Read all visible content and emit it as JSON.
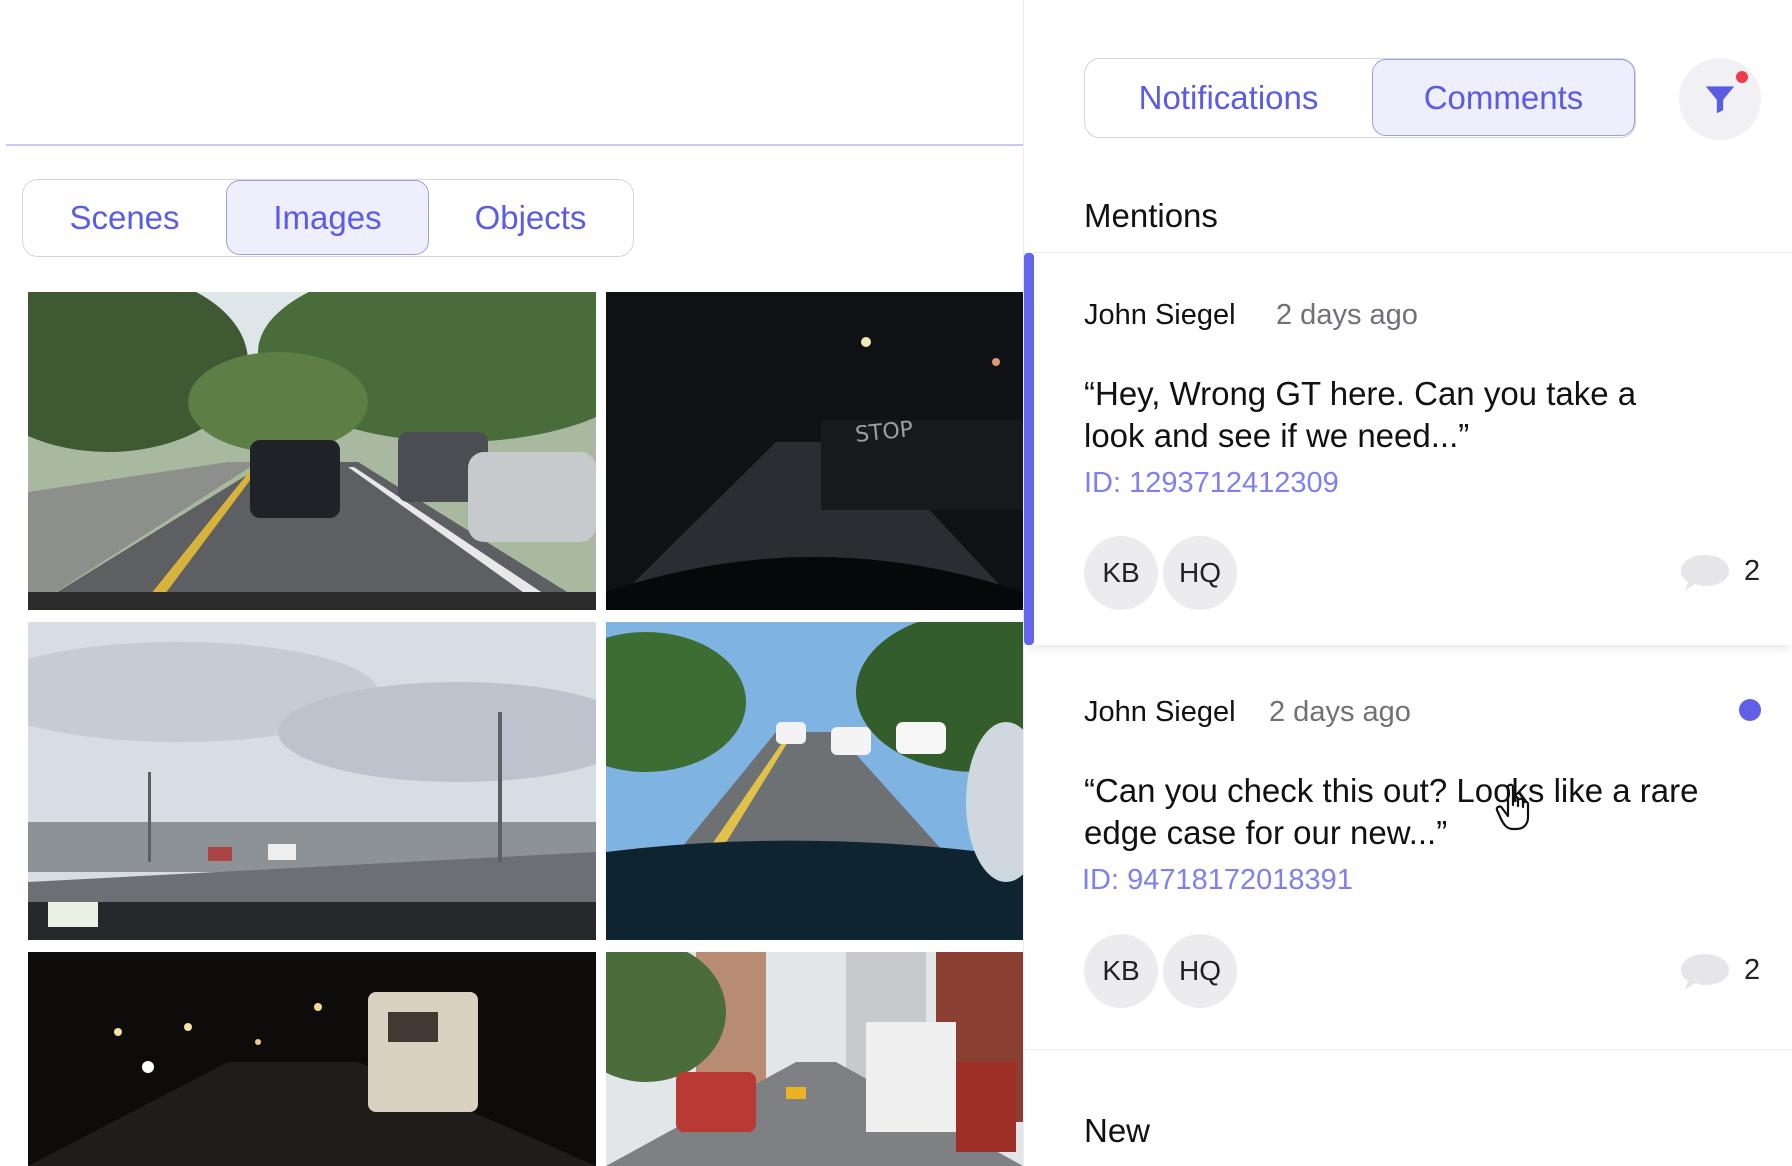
{
  "view_tabs": [
    {
      "label": "Scenes",
      "active": false
    },
    {
      "label": "Images",
      "active": true
    },
    {
      "label": "Objects",
      "active": false
    }
  ],
  "images": [
    {
      "name": "tree-lined-street-daytime"
    },
    {
      "name": "night-street-stop-marking"
    },
    {
      "name": "highway-overcast-sky"
    },
    {
      "name": "highway-sunny-trees"
    },
    {
      "name": "night-road-truck"
    },
    {
      "name": "city-street-buildings-truck"
    }
  ],
  "panel": {
    "tabs": [
      {
        "label": "Notifications",
        "active": false
      },
      {
        "label": "Comments",
        "active": true
      }
    ],
    "filter_icon": "filter-icon",
    "mentions_heading": "Mentions",
    "new_heading": "New"
  },
  "comments": [
    {
      "author": "John Siegel",
      "time": "2 days ago",
      "quote": "“Hey, Wrong GT here. Can you take a look and see if we need...”",
      "id_text": "ID: 1293712412309",
      "avatars": [
        "KB",
        "HQ"
      ],
      "reply_count": "2",
      "selected": true,
      "unread": false
    },
    {
      "author": "John Siegel",
      "time": "2 days ago",
      "quote": "“Can you check this out? Looks like a rare edge case for our new...”",
      "id_text": "ID: 94718172018391",
      "avatars": [
        "KB",
        "HQ"
      ],
      "reply_count": "2",
      "selected": false,
      "unread": true
    }
  ],
  "colors": {
    "accent": "#5b5ce6",
    "accent_light": "#eeeefc",
    "id_link": "#7f7ff0",
    "unread": "#5f5fe8",
    "filter_badge": "#ef3b4b"
  }
}
